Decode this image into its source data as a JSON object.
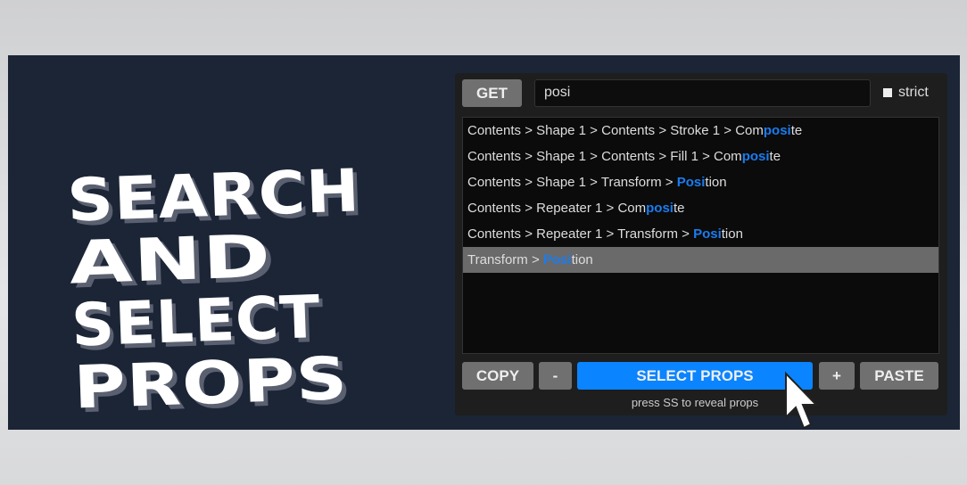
{
  "title": {
    "lines": [
      "SEARCH",
      "AND",
      "SELECT",
      "PROPS"
    ]
  },
  "toolbar": {
    "get_label": "GET",
    "search_value": "posi",
    "strict_label": "strict",
    "strict_checked": false
  },
  "results": [
    {
      "prefix": "Contents > Shape 1 > Contents > Stroke 1 > Com",
      "match": "posi",
      "suffix": "te",
      "selected": false
    },
    {
      "prefix": "Contents > Shape 1 > Contents > Fill 1 > Com",
      "match": "posi",
      "suffix": "te",
      "selected": false
    },
    {
      "prefix": "Contents > Shape 1 > Transform > ",
      "match": "Posi",
      "suffix": "tion",
      "selected": false
    },
    {
      "prefix": "Contents > Repeater 1 > Com",
      "match": "posi",
      "suffix": "te",
      "selected": false
    },
    {
      "prefix": "Contents > Repeater 1 > Transform > ",
      "match": "Posi",
      "suffix": "tion",
      "selected": false
    },
    {
      "prefix": "Transform > ",
      "match": "Posi",
      "suffix": "tion",
      "selected": true
    }
  ],
  "actions": {
    "copy": "COPY",
    "minus": "-",
    "select_props": "SELECT PROPS",
    "plus": "+",
    "paste": "PASTE",
    "hint": "press SS to reveal props"
  },
  "colors": {
    "accent": "#0a84ff",
    "frame": "#1b2536",
    "panel": "#1e1e1e",
    "match": "#1a7cf0"
  }
}
